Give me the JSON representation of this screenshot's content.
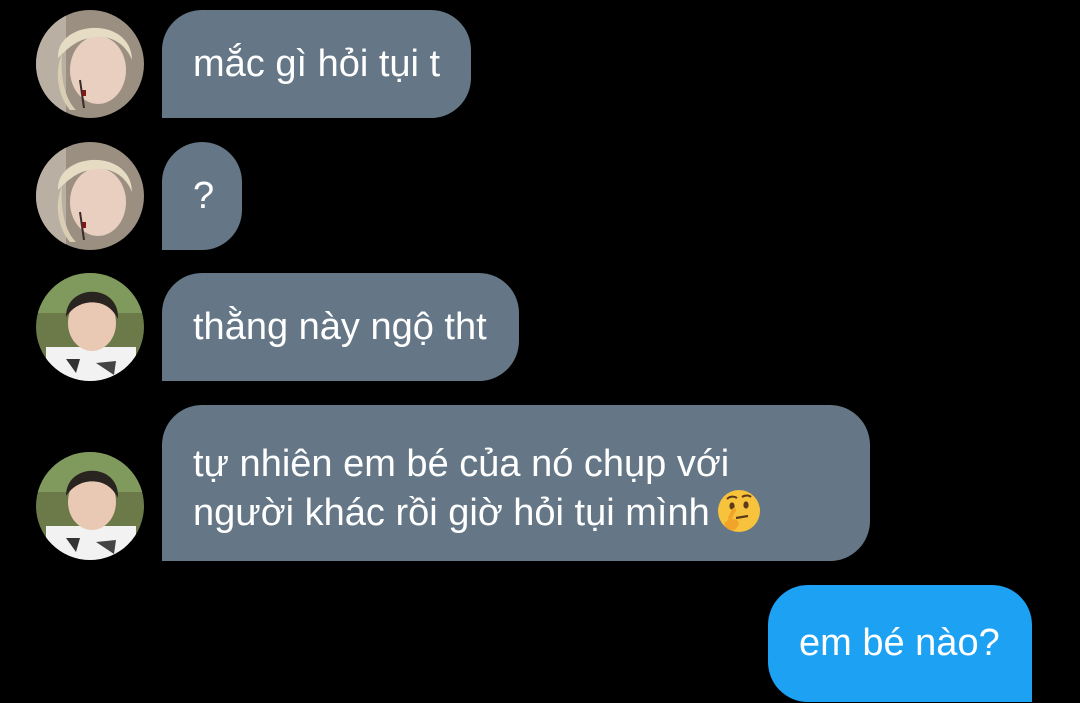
{
  "conversation": {
    "messages": [
      {
        "sender": "user_a",
        "direction": "incoming",
        "text": "mắc gì hỏi tụi t"
      },
      {
        "sender": "user_a",
        "direction": "incoming",
        "text": "?"
      },
      {
        "sender": "user_b",
        "direction": "incoming",
        "text": "thằng này ngộ tht"
      },
      {
        "sender": "user_b",
        "direction": "incoming",
        "lines": [
          "tự nhiên em bé của nó chụp với",
          "người khác rồi giờ hỏi tụi mình"
        ],
        "trailing_emoji": "thinking-face-icon"
      },
      {
        "sender": "me",
        "direction": "outgoing",
        "text": "em bé nào?"
      }
    ]
  },
  "avatars": {
    "user_a": "avatar-blonde-hair",
    "user_b": "avatar-dark-hair-white-shirt"
  },
  "colors": {
    "background": "#000000",
    "incoming_bubble": "#657786",
    "outgoing_bubble": "#1da1f2",
    "text": "#ffffff"
  }
}
